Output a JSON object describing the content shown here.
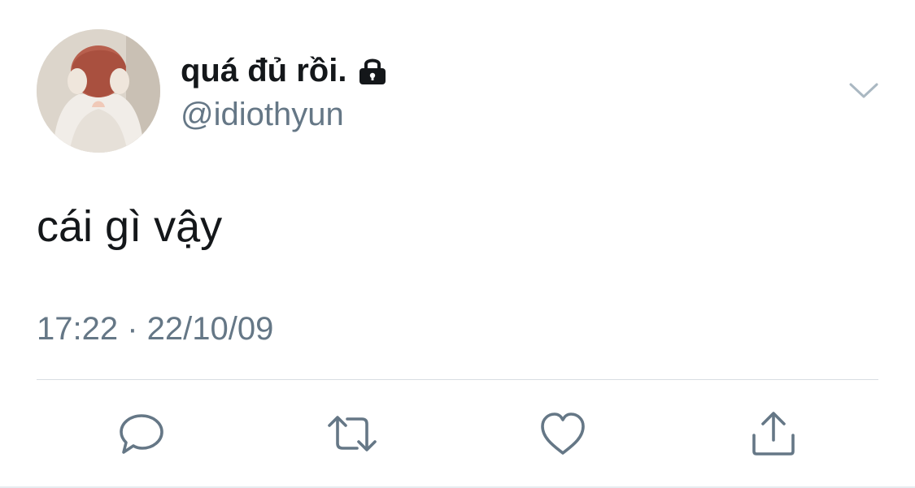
{
  "tweet": {
    "author": {
      "display_name": "quá đủ rồi.",
      "handle": "@idiothyun",
      "protected_icon": "lock-icon",
      "avatar": "avatar"
    },
    "text": "cái gì vậy",
    "timestamp": "17:22 · 22/10/09"
  },
  "actions": {
    "more": "chevron-down-icon",
    "reply": "reply-icon",
    "retweet": "retweet-icon",
    "like": "heart-icon",
    "share": "share-icon"
  },
  "colors": {
    "text_primary": "#14171a",
    "text_secondary": "#657786",
    "icon_gray": "#657786",
    "divider": "#d8dde2",
    "chevron": "#aab8c2"
  }
}
